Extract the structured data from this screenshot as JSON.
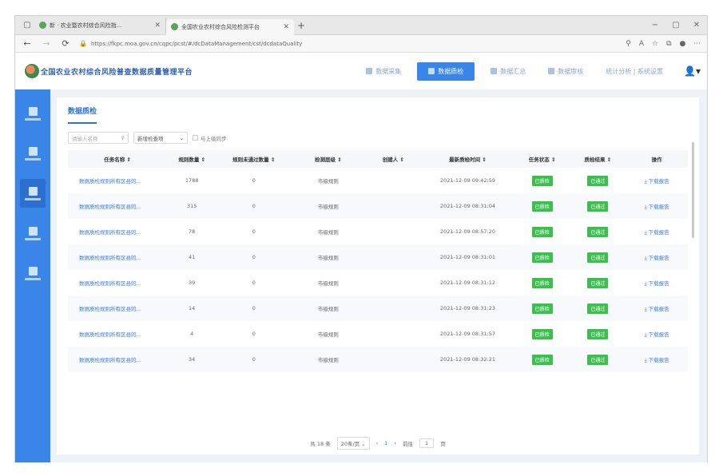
{
  "browser": {
    "tabs": [
      {
        "title": "新 · 农业暨农村综合风险指...",
        "active": false
      },
      {
        "title": "全国农业农村综合风险检测平台",
        "active": true
      }
    ],
    "url": "https://fkpc.moa.gov.cn/cqpc/pcst/#/dcDataManagement/cst/dcdataQuality",
    "win_controls": [
      "−",
      "▢",
      "✕"
    ]
  },
  "app": {
    "title": "全国农业农村综合风险普查数据质量管理平台",
    "topnav": [
      {
        "label": "数据采集",
        "active": false
      },
      {
        "label": "数据质检",
        "active": true
      },
      {
        "label": "数据汇总",
        "active": false
      },
      {
        "label": "数据审核",
        "active": false
      },
      {
        "label": "统计分析 | 系统设置",
        "active": false
      }
    ]
  },
  "panel": {
    "title": "数据质检",
    "search_placeholder": "请输入名称",
    "select_label": "新增检查项",
    "checkbox_label": "与上级同步"
  },
  "table": {
    "headers": [
      "任务名称",
      "规则数量",
      "规则未通过数量",
      "检测层级",
      "创建人",
      "最新质检时间",
      "任务状态",
      "质检结果",
      "操作"
    ],
    "rows": [
      {
        "name": "数据质检规则所有区县的...",
        "rules": "1788",
        "failed": "0",
        "level": "市级规则",
        "creator": "",
        "time": "2021-12-09 09:42:59",
        "status": "已质检",
        "result": "已通过",
        "action": "下载报告"
      },
      {
        "name": "数据质检规则所有区县的...",
        "rules": "315",
        "failed": "0",
        "level": "市级规则",
        "creator": "",
        "time": "2021-12-09 08:31:04",
        "status": "已质检",
        "result": "已通过",
        "action": "下载报告"
      },
      {
        "name": "数据质检规则所有区县的...",
        "rules": "78",
        "failed": "0",
        "level": "市级规则",
        "creator": "",
        "time": "2021-12-09 08:57:20",
        "status": "已质检",
        "result": "已通过",
        "action": "下载报告"
      },
      {
        "name": "数据质检规则所有区县的...",
        "rules": "41",
        "failed": "0",
        "level": "市级规则",
        "creator": "",
        "time": "2021-12-09 08:31:01",
        "status": "已质检",
        "result": "已通过",
        "action": "下载报告"
      },
      {
        "name": "数据质检规则所有区县的...",
        "rules": "39",
        "failed": "0",
        "level": "市级规则",
        "creator": "",
        "time": "2021-12-09 08:31:12",
        "status": "已质检",
        "result": "已通过",
        "action": "下载报告"
      },
      {
        "name": "数据质检规则所有区县的...",
        "rules": "14",
        "failed": "0",
        "level": "市级规则",
        "creator": "",
        "time": "2021-12-09 08:31:23",
        "status": "已质检",
        "result": "已通过",
        "action": "下载报告"
      },
      {
        "name": "数据质检规则所有区县的...",
        "rules": "4",
        "failed": "0",
        "level": "市级规则",
        "creator": "",
        "time": "2021-12-09 08:31:57",
        "status": "已质检",
        "result": "已通过",
        "action": "下载报告"
      },
      {
        "name": "数据质检规则所有区县的...",
        "rules": "34",
        "failed": "0",
        "level": "市级规则",
        "creator": "",
        "time": "2021-12-09 08:32:21",
        "status": "已质检",
        "result": "已通过",
        "action": "下载报告"
      }
    ]
  },
  "pager": {
    "total": "共 18 条",
    "page_size": "20条/页",
    "prev": "‹",
    "current": "1",
    "next": "›",
    "goto_label": "前往",
    "goto_value": "1",
    "page_unit": "页"
  },
  "colors": {
    "accent": "#3a86e8",
    "success": "#3cbf4f",
    "link": "#3b7de0"
  }
}
